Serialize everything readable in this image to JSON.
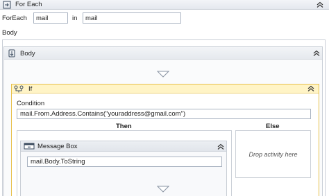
{
  "foreach": {
    "title": "For Each",
    "row_label": "ForEach",
    "item_value": "mail",
    "in_label": "in",
    "collection_value": "mail",
    "body_label": "Body"
  },
  "sequence": {
    "title": "Body"
  },
  "if_activity": {
    "title": "If",
    "condition_label": "Condition",
    "condition_value": "mail.From.Address.Contains(\"youraddress@gmail.com\")",
    "then_label": "Then",
    "else_label": "Else",
    "else_drop_text": "Drop activity here"
  },
  "message_box": {
    "title": "Message Box",
    "text_value": "mail.Body.ToString"
  },
  "colors": {
    "if_border": "#e7c04a",
    "if_header": "#fff4c6",
    "panel_border": "#c9ced6"
  },
  "icons": [
    "foreach-icon",
    "sequence-icon",
    "if-icon",
    "message-box-icon",
    "collapse-chevron-icon",
    "drop-arrow-icon"
  ]
}
